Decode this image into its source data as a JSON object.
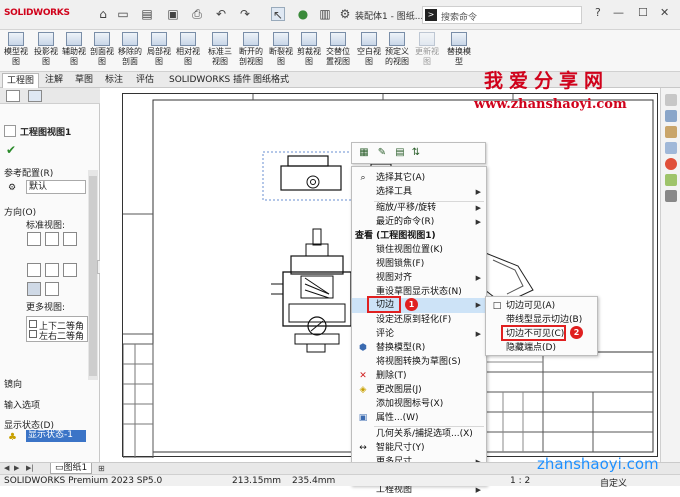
{
  "app": {
    "logo": "SOLIDWORKS",
    "doc_title": "装配体1 - 图纸...",
    "search_placeholder": "搜索命令"
  },
  "ribbon": [
    {
      "label1": "模型视",
      "label2": "图"
    },
    {
      "label1": "投影视",
      "label2": "图"
    },
    {
      "label1": "辅助视",
      "label2": "图"
    },
    {
      "label1": "剖面视",
      "label2": "图"
    },
    {
      "label1": "移除的",
      "label2": "剖面"
    },
    {
      "label1": "局部视",
      "label2": "图"
    },
    {
      "label1": "相对视",
      "label2": "图"
    },
    {
      "label1": "标准三",
      "label2": "视图"
    },
    {
      "label1": "断开的",
      "label2": "剖视图"
    },
    {
      "label1": "断裂视",
      "label2": "图"
    },
    {
      "label1": "剪裁视",
      "label2": "图"
    },
    {
      "label1": "交替位",
      "label2": "置视图"
    },
    {
      "label1": "空白视",
      "label2": "图"
    },
    {
      "label1": "预定义",
      "label2": "的视图"
    },
    {
      "label1": "更新视",
      "label2": "图"
    },
    {
      "label1": "替换模",
      "label2": "型"
    }
  ],
  "tabs": [
    "工程图",
    "注解",
    "草图",
    "标注",
    "评估",
    "SOLIDWORKS 插件",
    "图纸格式"
  ],
  "left_panel": {
    "title": "工程图视图1",
    "ref_config_label": "参考配置(R)",
    "config_value": "默认",
    "direction_label": "方向(O)",
    "std_views_label": "标准视图:",
    "more_views_label": "更多视图:",
    "more_view_1": "上下二等角",
    "more_view_2": "左右二等角",
    "mirror_label": "镜向",
    "import_label": "输入选项",
    "display_state_label": "显示状态(D)",
    "display_state_value": "显示状态-1"
  },
  "context_menu": {
    "items": [
      {
        "label": "选择其它",
        "key": "(A)"
      },
      {
        "label": "选择工具",
        "key": "",
        "arrow": true
      },
      {
        "label": "缩放/平移/旋转",
        "key": "",
        "arrow": true
      },
      {
        "label": "最近的命令",
        "key": "(R)",
        "arrow": true
      },
      {
        "label": "查看 (工程图视图1)",
        "key": "",
        "header": true
      },
      {
        "label": "锁住视图位置",
        "key": "(K)"
      },
      {
        "label": "视图锁焦",
        "key": "(F)"
      },
      {
        "label": "视图对齐",
        "key": "",
        "arrow": true
      },
      {
        "label": "重设草图显示状态",
        "key": "(N)"
      },
      {
        "label": "切边",
        "key": "",
        "arrow": true
      },
      {
        "label": "设定还原到轻化",
        "key": "(F)"
      },
      {
        "label": "评论",
        "key": "",
        "arrow": true
      },
      {
        "label": "替换模型",
        "key": "(R)"
      },
      {
        "label": "将视图转换为草图",
        "key": "(S)"
      },
      {
        "label": "删除",
        "key": "(T)"
      },
      {
        "label": "更改图层",
        "key": "(J)"
      },
      {
        "label": "添加视图标号",
        "key": "(X)"
      },
      {
        "label": "属性...",
        "key": "(W)"
      },
      {
        "label": "几何关系/捕捉选项...",
        "key": "(X)"
      },
      {
        "label": "智能尺寸",
        "key": "(Y)"
      },
      {
        "label": "更多尺寸",
        "key": "",
        "arrow": true
      },
      {
        "label": "注解",
        "key": "(A)",
        "arrow": true
      },
      {
        "label": "工程视图",
        "key": "",
        "arrow": true
      }
    ]
  },
  "submenu": {
    "items": [
      {
        "label": "切边可见",
        "key": "(A)"
      },
      {
        "label": "带线型显示切边",
        "key": "(B)"
      },
      {
        "label": "切边不可见",
        "key": "(C)"
      },
      {
        "label": "隐藏端点",
        "key": "(D)"
      }
    ]
  },
  "badges": [
    "1",
    "2"
  ],
  "watermark": {
    "big": "我爱分享网",
    "url": "www.zhanshaoyi.com",
    "bottom": "zhanshaoyi.com"
  },
  "sheet_tab": "图纸1",
  "status": {
    "app": "SOLIDWORKS Premium 2023 SP5.0",
    "x": "213.15mm",
    "y": "235.4mm",
    "scale": "1 : 2",
    "custom": "自定义"
  }
}
